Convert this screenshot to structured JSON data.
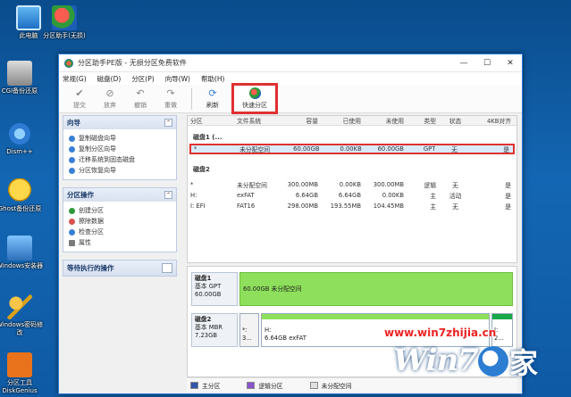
{
  "desktop": {
    "icons": [
      {
        "label": "此电脑"
      },
      {
        "label": "分区助手(无损)"
      },
      {
        "label": "CGI备份还原"
      },
      {
        "label": "Dism++"
      },
      {
        "label": "Ghost备份还原"
      },
      {
        "label": "Windows安装器"
      },
      {
        "label": "Windows密码修改"
      },
      {
        "label": "分区工具DiskGenius"
      }
    ]
  },
  "window": {
    "title": "分区助手PE版 - 无损分区免费软件",
    "controls": {
      "minimize": "—",
      "maximize": "☐",
      "close": "✕"
    }
  },
  "menu": [
    "常规(G)",
    "磁盘(D)",
    "分区(P)",
    "向导(W)",
    "帮助(H)"
  ],
  "toolbar": {
    "commit": "提交",
    "discard": "放弃",
    "undo": "撤销",
    "redo": "重做",
    "refresh": "刷新",
    "quick_partition": "快速分区"
  },
  "left_panel": {
    "wizard": {
      "title": "向导",
      "items": [
        "复制磁盘向导",
        "复制分区向导",
        "迁移系统到固态磁盘",
        "分区恢复向导"
      ]
    },
    "partition_ops": {
      "title": "分区操作",
      "items": [
        "创建分区",
        "擦除数据",
        "检查分区",
        "属性"
      ]
    },
    "pending": {
      "title": "等待执行的操作"
    }
  },
  "table": {
    "headers": [
      "分区",
      "文件系统",
      "容量",
      "已使用",
      "未使用",
      "类型",
      "状态",
      "4KB对齐"
    ],
    "disk1": {
      "label": "磁盘1 (...",
      "rows": [
        [
          "*",
          "未分配空间",
          "60.00GB",
          "0.00KB",
          "60.00GB",
          "GPT",
          "无",
          "是"
        ]
      ]
    },
    "disk2": {
      "label": "磁盘2",
      "rows": [
        [
          "*",
          "未分配空间",
          "300.00MB",
          "0.00KB",
          "300.00MB",
          "逻辑",
          "无",
          "是"
        ],
        [
          "H:",
          "exFAT",
          "6.64GB",
          "6.64GB",
          "0.00KB",
          "主",
          "活动",
          "是"
        ],
        [
          "I: EFI",
          "FAT16",
          "298.00MB",
          "193.55MB",
          "104.45MB",
          "主",
          "无",
          "是"
        ]
      ]
    }
  },
  "diskmap": {
    "disk1": {
      "name": "磁盘1",
      "type": "基本 GPT",
      "size": "60.00GB",
      "seg_text": "60.00GB 未分配空间"
    },
    "disk2": {
      "name": "磁盘2",
      "type": "基本 MBR",
      "size": "7.23GB",
      "seg1": "*:",
      "seg1_sub": "3...",
      "seg2": "H:",
      "seg2_sub": "6.64GB exFAT",
      "seg3": "I:",
      "seg3_sub": "2..."
    }
  },
  "legend": [
    "主分区",
    "逻辑分区",
    "未分配空间"
  ],
  "colors": {
    "primary": "#3355aa",
    "logical": "#8855cc",
    "unallocated": "#e0e0e0",
    "selection": "#e03030"
  },
  "watermark": {
    "url": "www.win7zhijia.cn",
    "logo_text": "Win7",
    "logo_suffix": "家"
  }
}
